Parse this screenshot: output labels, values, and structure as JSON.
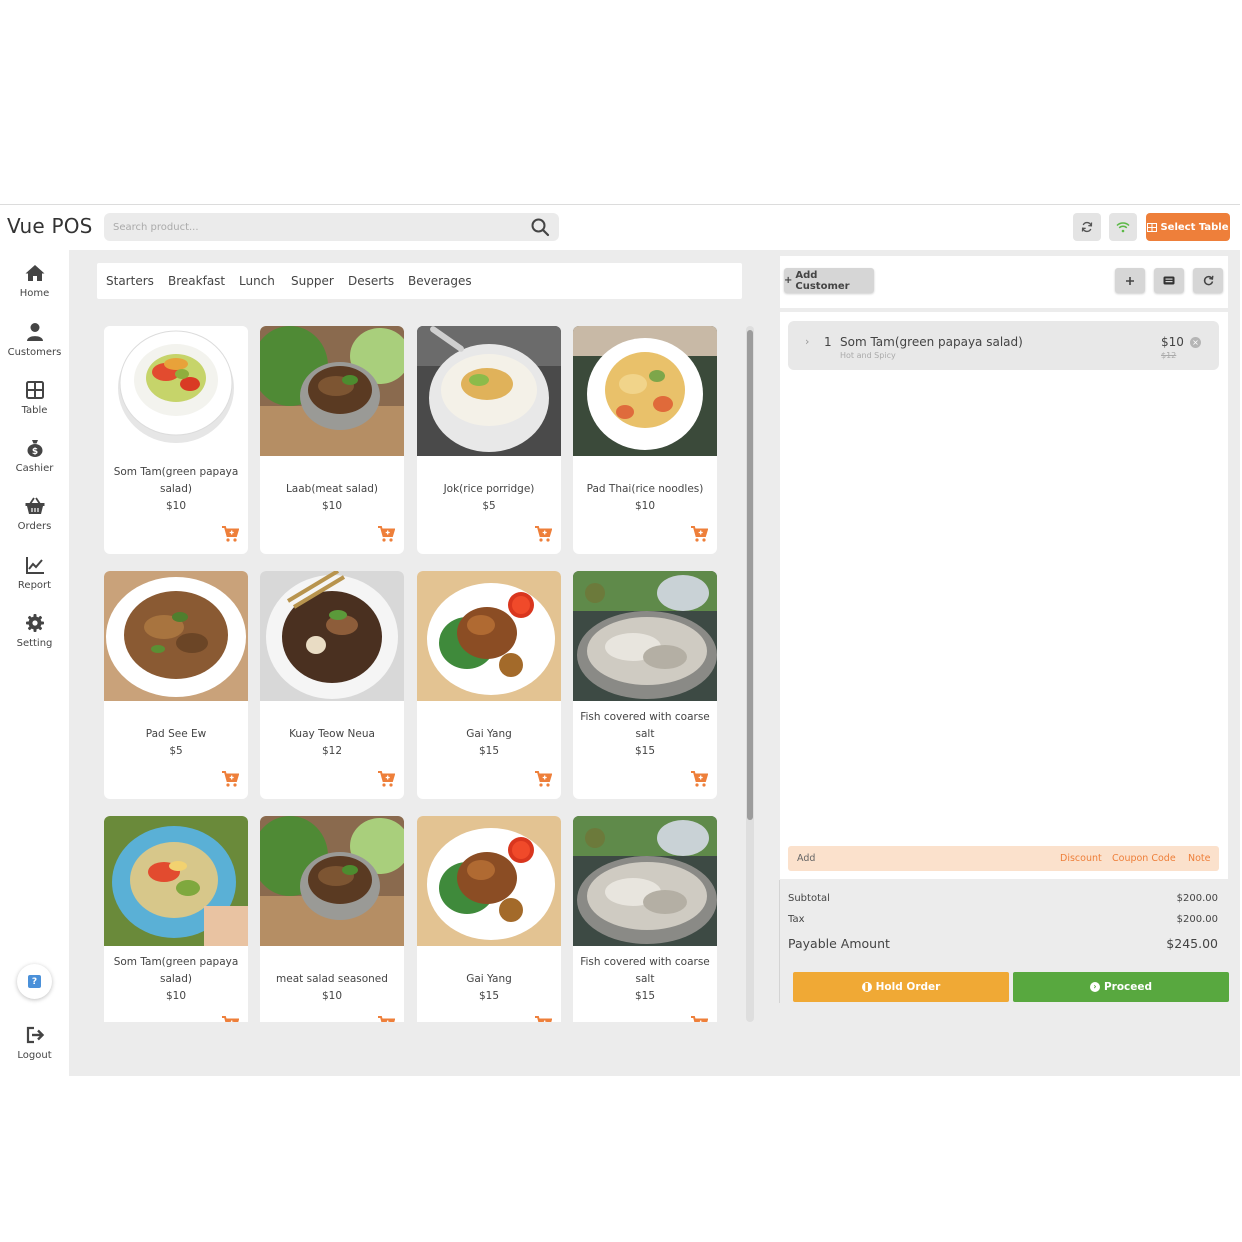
{
  "app": {
    "title": "Vue POS"
  },
  "search": {
    "placeholder": "Search product..."
  },
  "header": {
    "select_table_label": "Select Table"
  },
  "sidebar": {
    "items": [
      {
        "label": "Home",
        "icon": "home-icon"
      },
      {
        "label": "Customers",
        "icon": "user-icon"
      },
      {
        "label": "Table",
        "icon": "table-icon"
      },
      {
        "label": "Cashier",
        "icon": "money-bag-icon"
      },
      {
        "label": "Orders",
        "icon": "basket-icon"
      },
      {
        "label": "Report",
        "icon": "chart-icon"
      },
      {
        "label": "Setting",
        "icon": "gear-icon"
      }
    ],
    "help_label": "?",
    "logout_label": "Logout"
  },
  "categories": [
    "Starters",
    "Breakfast",
    "Lunch",
    "Supper",
    "Deserts",
    "Beverages"
  ],
  "products": [
    {
      "name_lines": [
        "Som Tam(green papaya",
        "salad)"
      ],
      "price": "$10"
    },
    {
      "name_lines": [
        "Laab(meat salad)"
      ],
      "price": "$10"
    },
    {
      "name_lines": [
        "Jok(rice porridge)"
      ],
      "price": "$5"
    },
    {
      "name_lines": [
        "Pad Thai(rice noodles)"
      ],
      "price": "$10"
    },
    {
      "name_lines": [
        "Pad See Ew"
      ],
      "price": "$5"
    },
    {
      "name_lines": [
        "Kuay Teow Neua"
      ],
      "price": "$12"
    },
    {
      "name_lines": [
        "Gai Yang"
      ],
      "price": "$15"
    },
    {
      "name_lines": [
        "Fish covered with coarse",
        "salt"
      ],
      "price": "$15"
    },
    {
      "name_lines": [
        "Som Tam(green papaya",
        "salad)"
      ],
      "price": "$10"
    },
    {
      "name_lines": [
        "meat salad seasoned"
      ],
      "price": "$10"
    },
    {
      "name_lines": [
        "Gai Yang"
      ],
      "price": "$15"
    },
    {
      "name_lines": [
        "Fish covered with coarse",
        "salt"
      ],
      "price": "$15"
    }
  ],
  "order": {
    "add_customer_label": "Add Customer",
    "items": [
      {
        "qty": "1",
        "name": "Som Tam(green papaya salad)",
        "note": "Hot and Spicy",
        "price": "$10",
        "old_price": "$12"
      }
    ],
    "actions": {
      "add": "Add",
      "discount": "Discount",
      "coupon": "Coupon Code",
      "note": "Note"
    }
  },
  "totals": {
    "subtotal_label": "Subtotal",
    "subtotal": "$200.00",
    "tax_label": "Tax",
    "tax": "$200.00",
    "payable_label": "Payable Amount",
    "payable": "$245.00"
  },
  "buttons": {
    "hold_order": "Hold Order",
    "proceed": "Proceed"
  },
  "colors": {
    "accent": "#ee7f3a",
    "hold": "#f0a935",
    "proceed": "#58a83f"
  }
}
